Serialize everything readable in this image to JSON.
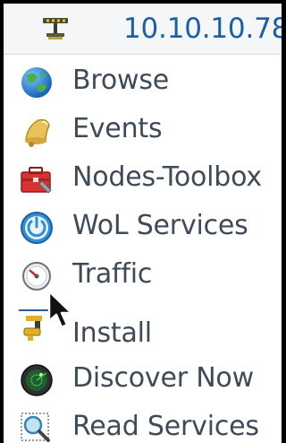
{
  "header": {
    "title": "10.10.10.78",
    "icon": "network-switch-icon"
  },
  "menu": {
    "items": [
      {
        "label": "Browse",
        "icon": "globe-icon"
      },
      {
        "label": "Events",
        "icon": "bell-icon"
      },
      {
        "label": "Nodes-Toolbox",
        "icon": "toolbox-icon"
      },
      {
        "label": "WoL Services",
        "icon": "power-icon"
      },
      {
        "label": "Traffic",
        "icon": "gauge-icon"
      },
      {
        "label": "Install",
        "icon": "install-icon"
      },
      {
        "label": "Discover Now",
        "icon": "radar-icon"
      },
      {
        "label": "Read Services",
        "icon": "magnifier-icon"
      }
    ]
  },
  "colors": {
    "title": "#1c5ea8",
    "label": "#3e4a57",
    "frame": "#000000"
  }
}
